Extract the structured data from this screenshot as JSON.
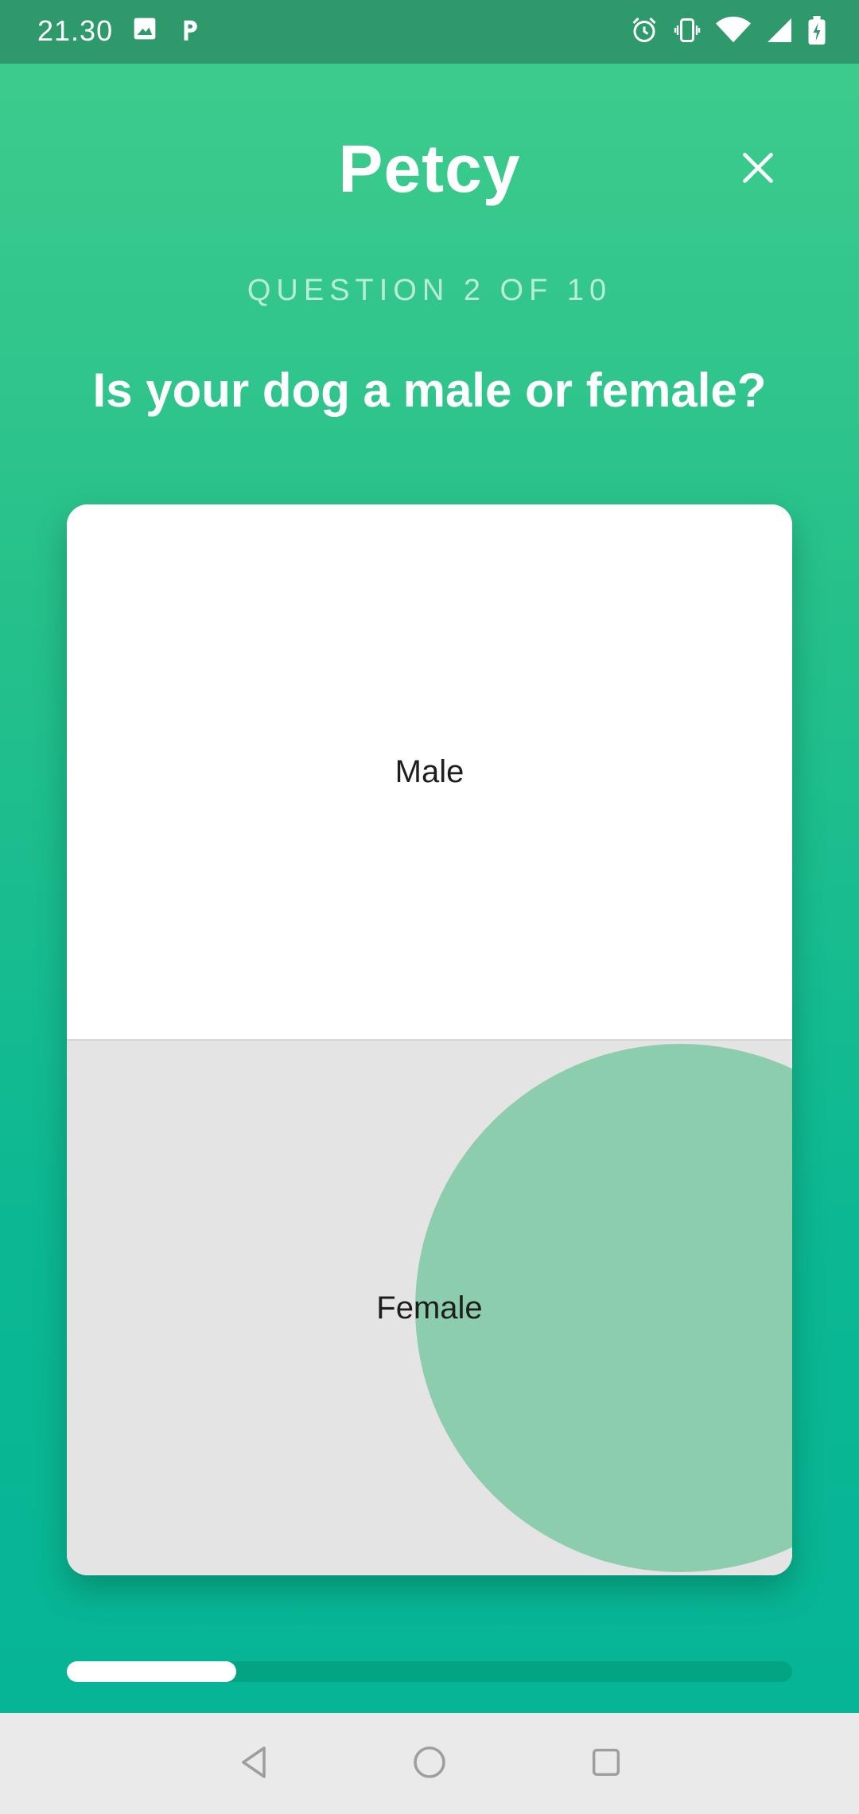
{
  "status_bar": {
    "time": "21.30",
    "left_icons": [
      "image-icon",
      "parking-icon"
    ],
    "right_icons": [
      "alarm-icon",
      "vibrate-icon",
      "wifi-icon",
      "signal-icon",
      "battery-charging-icon"
    ]
  },
  "header": {
    "title": "Petcy",
    "close_icon": "close-icon"
  },
  "quiz": {
    "counter": "QUESTION 2 OF 10",
    "question": "Is your dog a male or female?",
    "options": [
      {
        "label": "Male"
      },
      {
        "label": "Female"
      }
    ],
    "progress": 0.2
  },
  "colors": {
    "gradient_top": "#3dcb8d",
    "gradient_bottom": "#06b596",
    "progress_track": "#03a483",
    "progress_fill": "#ffffff",
    "ripple": "#8ccdae"
  },
  "nav_bar": {
    "icons": [
      "back-icon",
      "home-icon",
      "recents-icon"
    ]
  }
}
